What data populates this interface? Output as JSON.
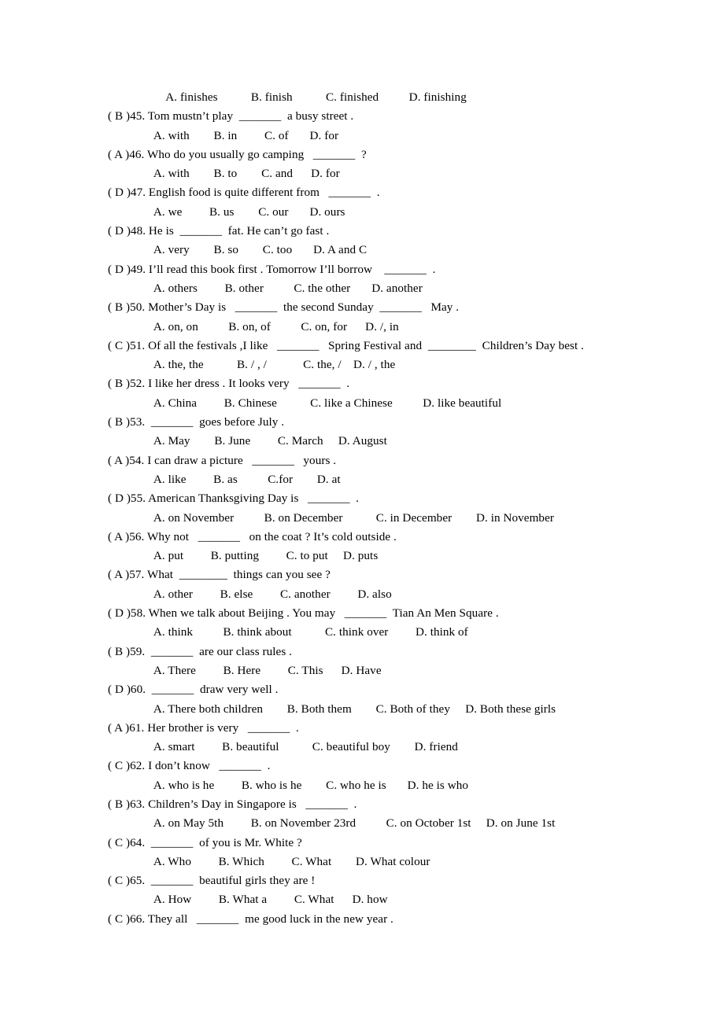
{
  "document": {
    "type": "multiple-choice-worksheet",
    "subject": "English grammar",
    "blank_marker": "_______",
    "answer_format": "( X )NN.",
    "page_background": "#ffffff",
    "text_color": "#000000"
  },
  "lines": [
    {
      "id": "opt-44",
      "kind": "options",
      "text": "      A. finishes           B. finish           C. finished          D. finishing"
    },
    {
      "id": "q-45",
      "kind": "question",
      "answer": "B",
      "number": "45",
      "text": "( B )45. Tom mustn’t play  _______  a busy street ."
    },
    {
      "id": "opt-45",
      "kind": "options",
      "text": "  A. with        B. in         C. of       D. for"
    },
    {
      "id": "q-46",
      "kind": "question",
      "answer": "A",
      "number": "46",
      "text": "( A )46. Who do you usually go camping   _______  ?"
    },
    {
      "id": "opt-46",
      "kind": "options",
      "text": "  A. with        B. to        C. and      D. for"
    },
    {
      "id": "q-47",
      "kind": "question",
      "answer": "D",
      "number": "47",
      "text": "( D )47. English food is quite different from   _______  ."
    },
    {
      "id": "opt-47",
      "kind": "options",
      "text": "  A. we         B. us        C. our       D. ours"
    },
    {
      "id": "q-48",
      "kind": "question",
      "answer": "D",
      "number": "48",
      "text": "( D )48. He is  _______  fat. He can’t go fast ."
    },
    {
      "id": "opt-48",
      "kind": "options",
      "text": "  A. very        B. so        C. too       D. A and C"
    },
    {
      "id": "q-49",
      "kind": "question",
      "answer": "D",
      "number": "49",
      "text": "( D )49. I’ll read this book first . Tomorrow I’ll borrow    _______  ."
    },
    {
      "id": "opt-49",
      "kind": "options",
      "text": "  A. others         B. other          C. the other       D. another"
    },
    {
      "id": "q-50",
      "kind": "question",
      "answer": "B",
      "number": "50",
      "text": "( B )50. Mother’s Day is   _______  the second Sunday  _______   May ."
    },
    {
      "id": "opt-50",
      "kind": "options",
      "text": "  A. on, on          B. on, of          C. on, for      D. /, in"
    },
    {
      "id": "q-51",
      "kind": "question",
      "answer": "C",
      "number": "51",
      "text": "( C )51. Of all the festivals ,I like   _______   Spring Festival and  ________  Children’s Day best ."
    },
    {
      "id": "opt-51",
      "kind": "options",
      "text": "  A. the, the           B. / , /            C. the, /    D. / , the"
    },
    {
      "id": "q-52",
      "kind": "question",
      "answer": "B",
      "number": "52",
      "text": "( B )52. I like her dress . It looks very   _______  ."
    },
    {
      "id": "opt-52",
      "kind": "options",
      "text": "  A. China         B. Chinese           C. like a Chinese          D. like beautiful"
    },
    {
      "id": "q-53",
      "kind": "question",
      "answer": "B",
      "number": "53",
      "text": "( B )53.  _______  goes before July ."
    },
    {
      "id": "opt-53",
      "kind": "options",
      "text": "  A. May        B. June         C. March     D. August"
    },
    {
      "id": "q-54",
      "kind": "question",
      "answer": "A",
      "number": "54",
      "text": "( A )54. I can draw a picture   _______   yours ."
    },
    {
      "id": "opt-54",
      "kind": "options",
      "text": "  A. like         B. as          C.for        D. at"
    },
    {
      "id": "q-55",
      "kind": "question",
      "answer": "D",
      "number": "55",
      "text": "( D )55. American Thanksgiving Day is   _______  ."
    },
    {
      "id": "opt-55",
      "kind": "options",
      "text": "  A. on November          B. on December           C. in December        D. in November"
    },
    {
      "id": "q-56",
      "kind": "question",
      "answer": "A",
      "number": "56",
      "text": "( A )56. Why not   _______   on the coat ? It’s cold outside ."
    },
    {
      "id": "opt-56",
      "kind": "options",
      "text": "  A. put         B. putting         C. to put     D. puts"
    },
    {
      "id": "q-57",
      "kind": "question",
      "answer": "A",
      "number": "57",
      "text": "( A )57. What  ________  things can you see ?"
    },
    {
      "id": "opt-57",
      "kind": "options",
      "text": "  A. other         B. else         C. another         D. also"
    },
    {
      "id": "q-58",
      "kind": "question",
      "answer": "D",
      "number": "58",
      "text": "( D )58. When we talk about Beijing . You may   _______  Tian An Men Square ."
    },
    {
      "id": "opt-58",
      "kind": "options",
      "text": "  A. think          B. think about           C. think over         D. think of"
    },
    {
      "id": "q-59",
      "kind": "question",
      "answer": "B",
      "number": "59",
      "text": "( B )59.  _______  are our class rules ."
    },
    {
      "id": "opt-59",
      "kind": "options",
      "text": "  A. There         B. Here         C. This      D. Have"
    },
    {
      "id": "q-60",
      "kind": "question",
      "answer": "D",
      "number": "60",
      "text": "( D )60.  _______  draw very well ."
    },
    {
      "id": "opt-60",
      "kind": "options",
      "text": "  A. There both children        B. Both them        C. Both of they     D. Both these girls"
    },
    {
      "id": "q-61",
      "kind": "question",
      "answer": "A",
      "number": "61",
      "text": "( A )61. Her brother is very   _______  ."
    },
    {
      "id": "opt-61",
      "kind": "options",
      "text": "  A. smart         B. beautiful           C. beautiful boy        D. friend"
    },
    {
      "id": "q-62",
      "kind": "question",
      "answer": "C",
      "number": "62",
      "text": "( C )62. I don’t know   _______  ."
    },
    {
      "id": "opt-62",
      "kind": "options",
      "text": "  A. who is he         B. who is he        C. who he is       D. he is who"
    },
    {
      "id": "q-63",
      "kind": "question",
      "answer": "B",
      "number": "63",
      "text": "( B )63. Children’s Day in Singapore is   _______  ."
    },
    {
      "id": "opt-63",
      "kind": "options",
      "text": "  A. on May 5th         B. on November 23rd          C. on October 1st     D. on June 1st"
    },
    {
      "id": "q-64",
      "kind": "question",
      "answer": "C",
      "number": "64",
      "text": "( C )64.  _______  of you is Mr. White ?"
    },
    {
      "id": "opt-64",
      "kind": "options",
      "text": "  A. Who         B. Which         C. What        D. What colour"
    },
    {
      "id": "q-65",
      "kind": "question",
      "answer": "C",
      "number": "65",
      "text": "( C )65.  _______  beautiful girls they are !"
    },
    {
      "id": "opt-65",
      "kind": "options",
      "text": "  A. How         B. What a         C. What      D. how"
    },
    {
      "id": "q-66",
      "kind": "question",
      "answer": "C",
      "number": "66",
      "text": "( C )66. They all   _______  me good luck in the new year ."
    }
  ]
}
